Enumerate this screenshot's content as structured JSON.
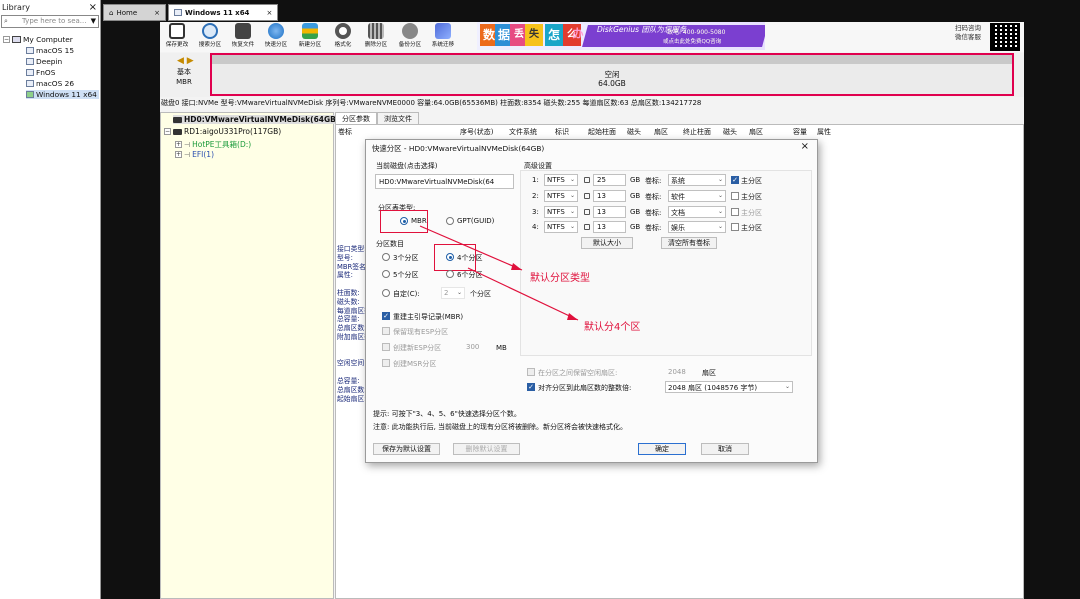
{
  "library": {
    "title": "Library",
    "search_placeholder": "Type here to sea...",
    "items": [
      {
        "label": "My Computer"
      },
      {
        "label": "macOS 15"
      },
      {
        "label": "Deepin"
      },
      {
        "label": "FnOS"
      },
      {
        "label": "macOS 26"
      },
      {
        "label": "Windows 11 x64"
      }
    ]
  },
  "vm_tabs": [
    {
      "label": "Home"
    },
    {
      "label": "Windows 11 x64"
    }
  ],
  "toolbar": {
    "buttons": [
      {
        "label": "保存更改",
        "color": "#3a3a3a"
      },
      {
        "label": "搜索分区",
        "color": "#2c6fb7"
      },
      {
        "label": "恢复文件",
        "color": "#555555"
      },
      {
        "label": "快速分区",
        "color": "#1a6fc4"
      },
      {
        "label": "新建分区",
        "color": "#d98b00"
      },
      {
        "label": "格式化",
        "color": "#4a4a4a"
      },
      {
        "label": "删除分区",
        "color": "#555555"
      },
      {
        "label": "备份分区",
        "color": "#6b6b6b"
      },
      {
        "label": "系统迁移",
        "color": "#4f6bd8"
      }
    ],
    "banner": {
      "chars": [
        "数",
        "据",
        "丢",
        "失",
        "怎",
        "么",
        "办"
      ],
      "title": "DiskGenius 团队为您服务",
      "phone": "致电: 400-900-5080",
      "qq_text": "或点击此处免费QQ咨询"
    },
    "qr_text_line1": "扫码咨询",
    "qr_text_line2": "微信客服"
  },
  "diskmap": {
    "basic_line1": "基本",
    "basic_line2": "MBR",
    "free_label": "空闲",
    "free_size": "64.0GB"
  },
  "disk_info": "磁盘0 接口:NVMe  型号:VMwareVirtualNVMeDisk  序列号:VMwareNVME0000  容量:64.0GB(65536MB)  柱面数:8354  磁头数:255  每道扇区数:63  总扇区数:134217728",
  "tree": {
    "items": [
      {
        "label": "HD0:VMwareVirtualNVMeDisk(64GB)"
      },
      {
        "label": "RD1:aigoU331Pro(117GB)"
      },
      {
        "label": "HotPE工具箱(D:)"
      },
      {
        "label": "EFI(1)"
      }
    ]
  },
  "right_tabs": [
    {
      "label": "分区参数"
    },
    {
      "label": "浏览文件"
    }
  ],
  "columns": [
    "卷标",
    "序号(状态)",
    "文件系统",
    "标识",
    "起始柱面",
    "磁头",
    "扇区",
    "终止柱面",
    "磁头",
    "扇区",
    "容量",
    "属性"
  ],
  "side_labels": [
    "接口类型:",
    "型号:",
    "MBR签名:",
    "属性:",
    "",
    "柱面数:",
    "磁头数:",
    "每道扇区数:",
    "总容量:",
    "总扇区数:",
    "附加扇区数:",
    "",
    "",
    "空闲空间",
    "",
    "总容量:",
    "总扇区数:",
    "起始扇区:"
  ],
  "dialog": {
    "title": "快速分区 - HD0:VMwareVirtualNVMeDisk(64GB)",
    "current_disk_label": "当前磁盘(点击选择)",
    "current_disk_value": "HD0:VMwareVirtualNVMeDisk(64",
    "table_type_label": "分区表类型:",
    "mbr_label": "MBR",
    "gpt_label": "GPT(GUID)",
    "count_label": "分区数目",
    "opt3": "3个分区",
    "opt4": "4个分区",
    "opt5": "5个分区",
    "opt6": "6个分区",
    "custom_label": "自定(C):",
    "custom_value": "2",
    "custom_unit": "个分区",
    "rebuild_mbr": "重建主引导记录(MBR)",
    "keep_esp": "保留现有ESP分区",
    "create_esp": "创建新ESP分区",
    "esp_size": "300",
    "esp_unit": "MB",
    "create_msr": "创建MSR分区",
    "advanced_label": "高级设置",
    "partitions": [
      {
        "num": "1:",
        "fs": "NTFS",
        "size": "25",
        "unit": "GB",
        "vol_label": "卷标:",
        "vol": "系统",
        "primary": "主分区",
        "primary_checked": true
      },
      {
        "num": "2:",
        "fs": "NTFS",
        "size": "13",
        "unit": "GB",
        "vol_label": "卷标:",
        "vol": "软件",
        "primary": "主分区",
        "primary_checked": false
      },
      {
        "num": "3:",
        "fs": "NTFS",
        "size": "13",
        "unit": "GB",
        "vol_label": "卷标:",
        "vol": "文档",
        "primary": "主分区",
        "primary_checked": false
      },
      {
        "num": "4:",
        "fs": "NTFS",
        "size": "13",
        "unit": "GB",
        "vol_label": "卷标:",
        "vol": "娱乐",
        "primary": "主分区",
        "primary_checked": false
      }
    ],
    "default_size_btn": "默认大小",
    "clear_labels_btn": "清空所有卷标",
    "reserve_gap_label": "在分区之间保留空闲扇区:",
    "reserve_gap_value": "2048",
    "reserve_gap_unit": "扇区",
    "align_label": "对齐分区到此扇区数的整数倍:",
    "align_value": "2048 扇区 (1048576 字节)",
    "hint": "提示: 可按下\"3、4、5、6\"快速选择分区个数。",
    "note": "注意: 此功能执行后, 当前磁盘上的现有分区将被删除。新分区将会被快速格式化。",
    "save_default_btn": "保存为默认设置",
    "delete_default_btn": "删除默认设置",
    "ok_btn": "确定",
    "cancel_btn": "取消"
  },
  "annotations": {
    "type_note": "默认分区类型",
    "count_note": "默认分4个区"
  },
  "colors": {
    "highlight": "#e0113c",
    "accent": "#1f5fa8",
    "tree_bg": "#ffffe6"
  }
}
